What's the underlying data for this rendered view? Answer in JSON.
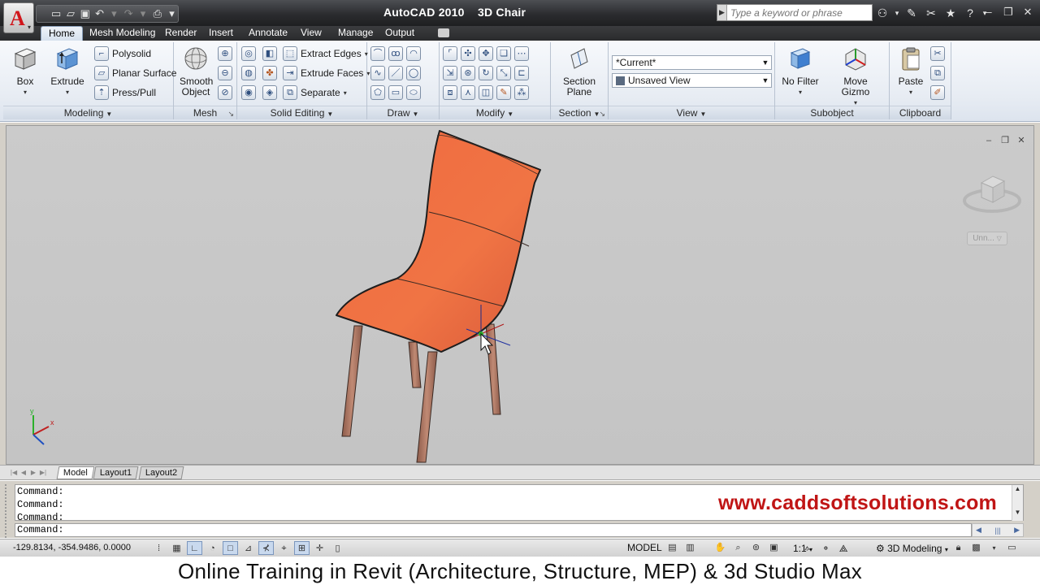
{
  "app": {
    "window_title": "AutoCAD 2010    3D Chair",
    "logo_letter": "A",
    "search_placeholder": "Type a keyword or phrase"
  },
  "quick_access": {
    "icons": [
      "new-icon",
      "open-icon",
      "save-icon",
      "undo-icon",
      "redo-icon",
      "plot-icon"
    ]
  },
  "ribbon_tabs": [
    "Home",
    "Mesh Modeling",
    "Render",
    "Insert",
    "Annotate",
    "View",
    "Manage",
    "Output"
  ],
  "active_tab": "Home",
  "panels": {
    "modeling": {
      "title": "Modeling",
      "box": "Box",
      "extrude": "Extrude",
      "polysolid": "Polysolid",
      "planar_surface": "Planar Surface",
      "press_pull": "Press/Pull"
    },
    "mesh": {
      "title": "Mesh",
      "smooth_object": "Smooth Object"
    },
    "solid_editing": {
      "title": "Solid Editing",
      "extract_edges": "Extract Edges",
      "extrude_faces": "Extrude Faces",
      "separate": "Separate"
    },
    "draw": {
      "title": "Draw"
    },
    "modify": {
      "title": "Modify"
    },
    "section": {
      "title": "Section",
      "section_plane": "Section Plane"
    },
    "view": {
      "title": "View",
      "visual_style": "*Current*",
      "named_view": "Unsaved View"
    },
    "subobject": {
      "title": "Subobject",
      "no_filter": "No Filter",
      "move_gizmo": "Move Gizmo"
    },
    "clipboard": {
      "title": "Clipboard",
      "paste": "Paste"
    }
  },
  "viewport": {
    "named_view_label": "Unn...",
    "ucs_x": "x",
    "ucs_y": "y",
    "chair_color": "#e8643e",
    "leg_color": "#b07a66"
  },
  "layout_tabs": [
    "Model",
    "Layout1",
    "Layout2"
  ],
  "command_window": {
    "history": [
      "Command:",
      "Command:",
      "Command:"
    ],
    "prompt": "Command:"
  },
  "watermark": "www.caddsoftsolutions.com",
  "status_bar": {
    "coordinates": "-129.8134, -354.9486, 0.0000",
    "model": "MODEL",
    "annotation_scale": "1:1",
    "workspace": "3D Modeling"
  },
  "caption": "Online Training in Revit (Architecture, Structure, MEP) & 3d Studio Max"
}
